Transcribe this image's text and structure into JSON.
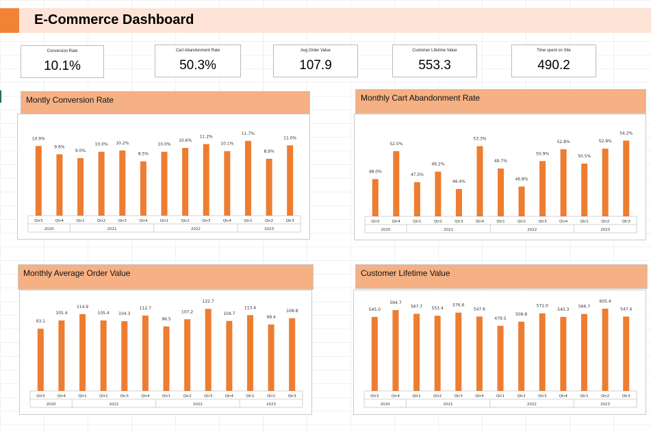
{
  "header": {
    "title": "E-Commerce Dashboard"
  },
  "colors": {
    "bar": "#ed7d31",
    "header_bg": "#fde4d6",
    "accent": "#f08336",
    "panel_title_bg": "#f5b083"
  },
  "kpis": [
    {
      "label": "Conversion Rate",
      "value": "10.1%"
    },
    {
      "label": "Cart Abandonment Rate",
      "value": "50.3%"
    },
    {
      "label": "Avg Order Value",
      "value": "107.9"
    },
    {
      "label": "Customer Lifetime Value",
      "value": "553.3"
    },
    {
      "label": "Time spent on Site",
      "value": "490.2"
    }
  ],
  "panels": [
    {
      "title": "Montly Conversion Rate"
    },
    {
      "title": "Monthly Cart Abandonment Rate"
    },
    {
      "title": "Monthly Average Order Value"
    },
    {
      "title": "Customer Lifetime Value"
    }
  ],
  "chart_data": [
    {
      "type": "bar",
      "title": "Montly Conversion Rate",
      "categories": [
        "Qtr3",
        "Qtr4",
        "Qtr1",
        "Qtr2",
        "Qtr3",
        "Qtr4",
        "Qtr1",
        "Qtr2",
        "Qtr3",
        "Qtr4",
        "Qtr1",
        "Qtr2",
        "Qtr3"
      ],
      "groups": [
        {
          "label": "2020",
          "count": 2
        },
        {
          "label": "2021",
          "count": 4
        },
        {
          "label": "2022",
          "count": 4
        },
        {
          "label": "2023",
          "count": 3
        }
      ],
      "values": [
        10.9,
        9.6,
        9.0,
        10.0,
        10.2,
        8.5,
        10.0,
        10.6,
        11.2,
        10.1,
        11.7,
        8.9,
        11.0
      ],
      "value_labels": [
        "10.9%",
        "9.6%",
        "9.0%",
        "10.0%",
        "10.2%",
        "8.5%",
        "10.0%",
        "10.6%",
        "11.2%",
        "10.1%",
        "11.7%",
        "8.9%",
        "11.0%"
      ],
      "ylim": [
        0,
        13.5
      ]
    },
    {
      "type": "bar",
      "title": "Monthly Cart Abandonment Rate",
      "categories": [
        "Qtr3",
        "Qtr4",
        "Qtr1",
        "Qtr2",
        "Qtr3",
        "Qtr4",
        "Qtr1",
        "Qtr2",
        "Qtr3",
        "Qtr4",
        "Qtr1",
        "Qtr2",
        "Qtr3"
      ],
      "groups": [
        {
          "label": "2020",
          "count": 2
        },
        {
          "label": "2021",
          "count": 4
        },
        {
          "label": "2022",
          "count": 4
        },
        {
          "label": "2023",
          "count": 3
        }
      ],
      "values": [
        48.0,
        52.5,
        47.5,
        49.2,
        46.4,
        53.3,
        49.7,
        46.8,
        50.9,
        52.8,
        50.5,
        52.9,
        54.2
      ],
      "value_labels": [
        "48.0%",
        "52.5%",
        "47.5%",
        "49.2%",
        "46.4%",
        "53.3%",
        "49.7%",
        "46.8%",
        "50.9%",
        "52.8%",
        "50.5%",
        "52.9%",
        "54.2%"
      ],
      "ylim": [
        42,
        56
      ]
    },
    {
      "type": "bar",
      "title": "Monthly Average Order Value",
      "categories": [
        "Qtr3",
        "Qtr4",
        "Qtr1",
        "Qtr2",
        "Qtr3",
        "Qtr4",
        "Qtr1",
        "Qtr2",
        "Qtr3",
        "Qtr4",
        "Qtr1",
        "Qtr2",
        "Qtr3"
      ],
      "groups": [
        {
          "label": "2020",
          "count": 2
        },
        {
          "label": "2021",
          "count": 4
        },
        {
          "label": "2022",
          "count": 4
        },
        {
          "label": "2023",
          "count": 3
        }
      ],
      "values": [
        93.1,
        105.4,
        114.9,
        105.4,
        104.3,
        112.7,
        96.5,
        107.2,
        122.7,
        104.7,
        113.4,
        99.4,
        108.8
      ],
      "value_labels": [
        "93.1",
        "105.4",
        "114.9",
        "105.4",
        "104.3",
        "112.7",
        "96.5",
        "107.2",
        "122.7",
        "104.7",
        "113.4",
        "99.4",
        "108.8"
      ],
      "ylim": [
        0,
        128
      ]
    },
    {
      "type": "bar",
      "title": "Customer Lifetime Value",
      "categories": [
        "Qtr3",
        "Qtr4",
        "Qtr1",
        "Qtr2",
        "Qtr3",
        "Qtr4",
        "Qtr1",
        "Qtr2",
        "Qtr3",
        "Qtr4",
        "Qtr1",
        "Qtr2",
        "Qtr3"
      ],
      "groups": [
        {
          "label": "2020",
          "count": 2
        },
        {
          "label": "2021",
          "count": 4
        },
        {
          "label": "2022",
          "count": 4
        },
        {
          "label": "2023",
          "count": 3
        }
      ],
      "values": [
        545.0,
        594.7,
        567.7,
        553.4,
        576.6,
        547.6,
        479.5,
        509.8,
        571.0,
        545.3,
        566.7,
        605.4,
        547.4
      ],
      "value_labels": [
        "545.0",
        "594.7",
        "567.7",
        "553.4",
        "576.6",
        "547.6",
        "479.5",
        "509.8",
        "571.0",
        "545.3",
        "566.7",
        "605.4",
        "547.4"
      ],
      "ylim": [
        0,
        630
      ]
    }
  ]
}
